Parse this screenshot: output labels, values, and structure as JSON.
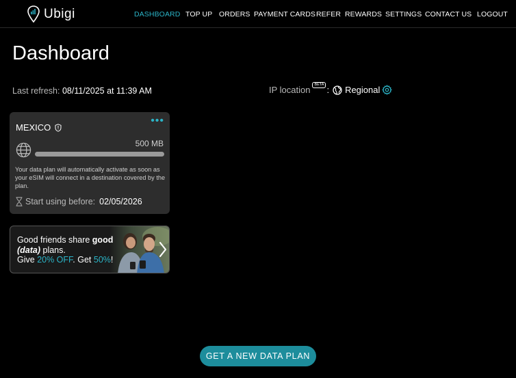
{
  "brand": {
    "name": "Ubigi"
  },
  "nav": {
    "items": [
      {
        "label": "DASHBOARD",
        "active": true
      },
      {
        "label": "TOP UP"
      },
      {
        "label": "ORDERS"
      },
      {
        "label": "PAYMENT CARDS"
      },
      {
        "label": "REFER"
      },
      {
        "label": "REWARDS"
      },
      {
        "label": "SETTINGS"
      },
      {
        "label": "CONTACT US"
      },
      {
        "label": "LOGOUT"
      }
    ]
  },
  "page": {
    "title": "Dashboard"
  },
  "refresh": {
    "label": "Last refresh:",
    "date": "08/11/2025",
    "at": "at",
    "time": "11:39 AM"
  },
  "ip_location": {
    "label": "IP location",
    "badge": "BETA",
    "separator": ":",
    "value": "Regional"
  },
  "plan": {
    "country": "MEXICO",
    "data_amount": "500 MB",
    "progress_fraction": 0,
    "note": "Your data plan will automatically activate as soon as your eSIM will connect in a destination covered by the plan.",
    "start_label": "Start using before:",
    "start_date": "02/05/2026"
  },
  "promo": {
    "line1_prefix": "Good friends share ",
    "line1_bold": "good",
    "line2_italic": "(data)",
    "line2_rest": " plans.",
    "line3_prefix": "Give ",
    "line3_off": "20% OFF",
    "line3_mid": ". Get ",
    "line3_get": "50%",
    "line3_end": "!"
  },
  "cta": {
    "label": "GET A NEW DATA PLAN"
  },
  "colors": {
    "accent": "#2bb4c7",
    "cta": "#1d8d9c",
    "card": "#2d2d2d",
    "background": "#000000"
  },
  "icons": {
    "logo": "location-pin-signal-icon",
    "plan_badge": "shield-info-icon",
    "globe": "globe-icon",
    "hourglass": "hourglass-icon",
    "ip_globe": "world-icon",
    "settings": "gear-icon",
    "more": "more-dots-icon",
    "chevron": "chevron-right-icon"
  }
}
